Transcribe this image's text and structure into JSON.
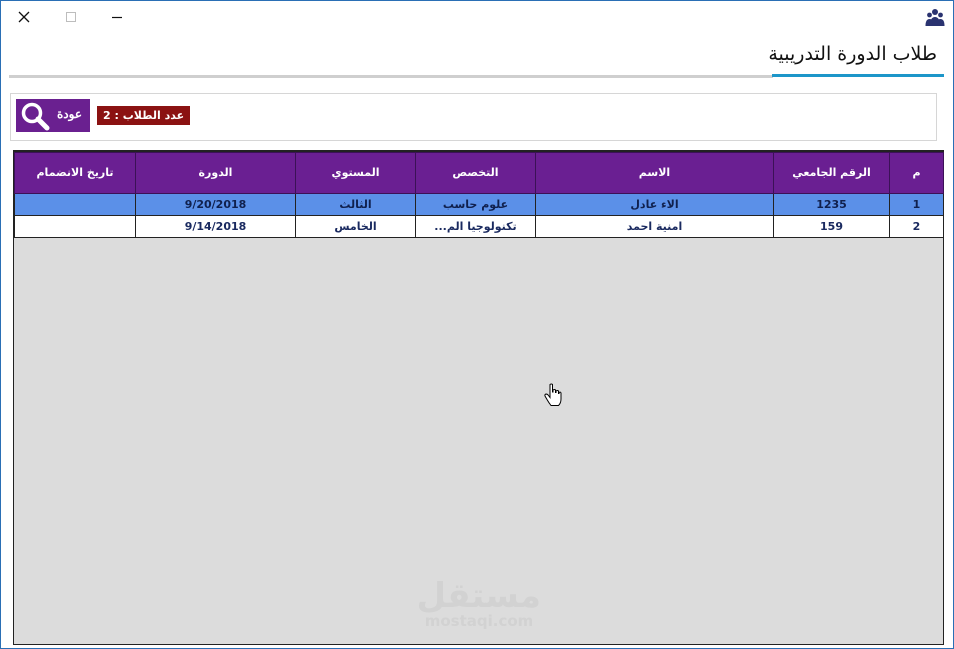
{
  "window": {
    "title": "طلاب الدورة التدريبية"
  },
  "toolbar": {
    "back_label": "عودة",
    "student_count": "عدد الطلاب : 2"
  },
  "grid": {
    "columns": [
      "م",
      "الرقم الجامعي",
      "الاسم",
      "التخصص",
      "المستوي",
      "الدورة",
      "تاريخ الانضمام"
    ],
    "rows": [
      {
        "num": "1",
        "university_id": "1235",
        "name": "الاء عادل",
        "major": "علوم حاسب",
        "level": "الثالث",
        "course": "9/20/2018",
        "join_date": ""
      },
      {
        "num": "2",
        "university_id": "159",
        "name": "امنية احمد",
        "major": "تكنولوجيا الم...",
        "level": "الخامس",
        "course": "9/14/2018",
        "join_date": ""
      }
    ],
    "selected_row": 1
  },
  "watermark": {
    "arabic": "مستقل",
    "english": "mostaqi.com"
  },
  "colors": {
    "header_bg": "#6a1f92",
    "selected_row": "#5b90e8",
    "badge_bg": "#8b1212",
    "accent": "#1c96c9"
  }
}
